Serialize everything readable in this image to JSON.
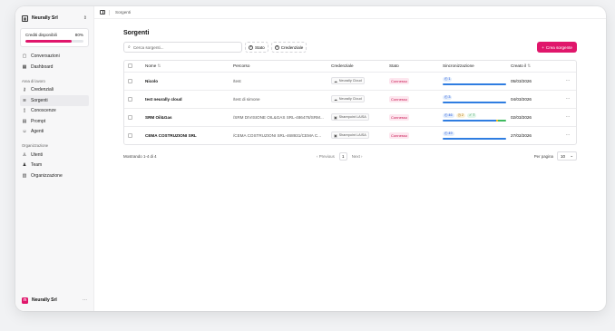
{
  "sidebar": {
    "org_name": "Neurally Srl",
    "credits": {
      "label": "Crediti disponibili",
      "percent_label": "80%",
      "percent": 0.8
    },
    "top_items": [
      {
        "label": "Conversazioni",
        "icon": "chat-icon"
      },
      {
        "label": "Dashboard",
        "icon": "grid-icon"
      }
    ],
    "workspace_label": "Area di lavoro",
    "workspace_items": [
      {
        "label": "Credenziali",
        "icon": "key-icon"
      },
      {
        "label": "Sorgenti",
        "icon": "database-icon",
        "active": true
      },
      {
        "label": "Conoscenze",
        "icon": "book-icon"
      },
      {
        "label": "Prompt",
        "icon": "document-icon"
      },
      {
        "label": "Agenti",
        "icon": "bot-icon"
      }
    ],
    "org_label": "Organizzazione",
    "org_items": [
      {
        "label": "Utenti",
        "icon": "user-icon"
      },
      {
        "label": "Team",
        "icon": "users-icon"
      },
      {
        "label": "Organizzazione",
        "icon": "building-icon"
      }
    ],
    "footer_name": "Neurally Srl",
    "footer_logo_letter": "n"
  },
  "topbar": {
    "breadcrumb": "Sorgenti"
  },
  "page": {
    "title": "Sorgenti",
    "search_placeholder": "Cerca sorgenti...",
    "filter_state": "Stato",
    "filter_credential": "Credenziale",
    "new_button": "Crea sorgente"
  },
  "table": {
    "headers": {
      "name": "Nome",
      "path": "Percorso",
      "credential": "Credenziale",
      "state": "Stato",
      "sync": "Sincronizzazione",
      "created": "Creato il"
    },
    "rows": [
      {
        "name": "Nicolo",
        "path": "/test",
        "credential": "Neurally Cloud",
        "credential_icon": "cloud-icon",
        "state": "Connesso",
        "badges": [
          {
            "type": "blue",
            "value": "1"
          }
        ],
        "bar": [
          {
            "color": "#2f7de1",
            "fraction": 1.0
          }
        ],
        "created": "05/03/2026"
      },
      {
        "name": "test neurally cloud",
        "path": "/test di simone",
        "credential": "Neurally Cloud",
        "credential_icon": "cloud-icon",
        "state": "Connesso",
        "badges": [
          {
            "type": "blue",
            "value": "3"
          }
        ],
        "bar": [
          {
            "color": "#2f7de1",
            "fraction": 1.0
          }
        ],
        "created": "04/03/2026"
      },
      {
        "name": "SRM Oil&Gas",
        "path": "/SRM DIVISIONE OIL&GAS SRL-486478/SRM...",
        "credential": "Sharepoint LAISA",
        "credential_icon": "sharepoint-icon",
        "state": "Connesso",
        "badges": [
          {
            "type": "blue",
            "value": "46"
          },
          {
            "type": "yellow",
            "value": "2"
          },
          {
            "type": "green",
            "value": "7"
          }
        ],
        "bar": [
          {
            "color": "#2f7de1",
            "fraction": 0.84
          },
          {
            "color": "#f2b51d",
            "fraction": 0.03
          },
          {
            "color": "#3fba5f",
            "fraction": 0.13
          }
        ],
        "created": "02/03/2026"
      },
      {
        "name": "CEMA COSTRUZIONI SRL",
        "path": "/CEMA COSTRUZIONI SRL-468931/CEMA C...",
        "credential": "Sharepoint LAISA",
        "credential_icon": "sharepoint-icon",
        "state": "Connesso",
        "badges": [
          {
            "type": "blue",
            "value": "49"
          }
        ],
        "bar": [
          {
            "color": "#2f7de1",
            "fraction": 1.0
          }
        ],
        "created": "27/02/2026"
      }
    ]
  },
  "footer": {
    "showing": "Mostrando 1-4 di 4",
    "previous": "Previous",
    "page": "1",
    "next": "Next",
    "per_page_label": "Per pagina",
    "per_page_value": "10"
  }
}
